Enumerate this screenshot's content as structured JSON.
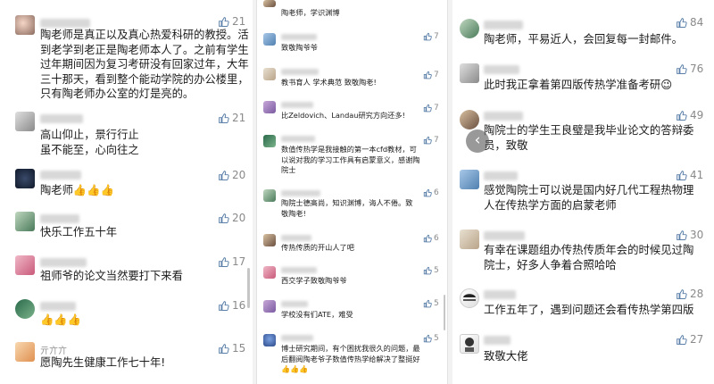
{
  "accent_color": "#5a7fa8",
  "like_icon": "thumbs-up-icon",
  "nav_arrow_icon": "chevron-left-icon",
  "left_comments": [
    {
      "text": [
        "陶老师是真正以及真心热爱科研的教授。活",
        "到老学到老正是陶老师本人了。之前有学生",
        "过年期间因为复习考研没有回家过年，大年",
        "三十那天，看到整个能动学院的办公楼里，",
        "只有陶老师办公室的灯是亮的。"
      ],
      "likes": "21"
    },
    {
      "text": [
        "高山仰止，景行行止",
        "虽不能至，心向往之"
      ],
      "likes": "21"
    },
    {
      "text": [
        "陶老师👍👍👍"
      ],
      "likes": "20"
    },
    {
      "text": [
        "快乐工作五十年"
      ],
      "likes": "20"
    },
    {
      "text": [
        "祖师爷的论文当然要打下来看"
      ],
      "likes": "17"
    },
    {
      "text": [
        "👍👍👍"
      ],
      "likes": "16"
    },
    {
      "nickname": "亓亣亣",
      "text": [
        "愿陶先生健康工作七十年!"
      ],
      "likes": "15"
    }
  ],
  "middle_comments": [
    {
      "text": [
        "陶老师，学识渊博"
      ],
      "likes": "7"
    },
    {
      "text": [
        "致敬陶爷爷"
      ],
      "likes": "7"
    },
    {
      "text": [
        "教书育人 学术典范 致敬陶老!"
      ],
      "likes": "7"
    },
    {
      "text": [
        "比Zeldovich、Landau研究方向还多!"
      ],
      "likes": "7"
    },
    {
      "text": [
        "数值传热学是我接触的第一本cfd教材，可",
        "以说对我的学习工作具有启蒙意义，感谢陶",
        "院士"
      ],
      "likes": "6"
    },
    {
      "text": [
        "陶院士德高尚，知识渊博，诲人不倦。致",
        "敬陶老!"
      ],
      "likes": "6"
    },
    {
      "text": [
        "传热传质的开山人了吧"
      ],
      "likes": "5"
    },
    {
      "text": [
        "西交学子致敬陶爷爷"
      ],
      "likes": "5"
    },
    {
      "text": [
        "学校没有们ATE，难受"
      ],
      "likes": "5"
    },
    {
      "text": [
        "博士研究期间，有个困扰我很久的问题，最",
        "后翻阅陶老爷子数值传热学给解决了整挺好",
        "👍👍👍"
      ],
      "likes": "5"
    }
  ],
  "right_comments": [
    {
      "text": [
        "陶老师，平易近人，会回复每一封邮件。"
      ],
      "likes": "84"
    },
    {
      "text": [
        "此时我正拿着第四版传热学准备考研😉"
      ],
      "likes": "76"
    },
    {
      "text": [
        "陶院士的学生王良璧是我毕业论文的答辩委",
        "员，致敬"
      ],
      "likes": "49"
    },
    {
      "text": [
        "感觉陶院士可以说是国内好几代工程热物理",
        "人在传热学方面的启蒙老师"
      ],
      "likes": "41"
    },
    {
      "text": [
        "有幸在课题组办传热传质年会的时候见过陶",
        "院士，好多人争着合照哈哈"
      ],
      "likes": "30"
    },
    {
      "text": [
        "工作五年了，遇到问题还会看传热学第四版"
      ],
      "likes": "28"
    },
    {
      "text": [
        "致敬大佬"
      ],
      "likes": "27"
    }
  ]
}
